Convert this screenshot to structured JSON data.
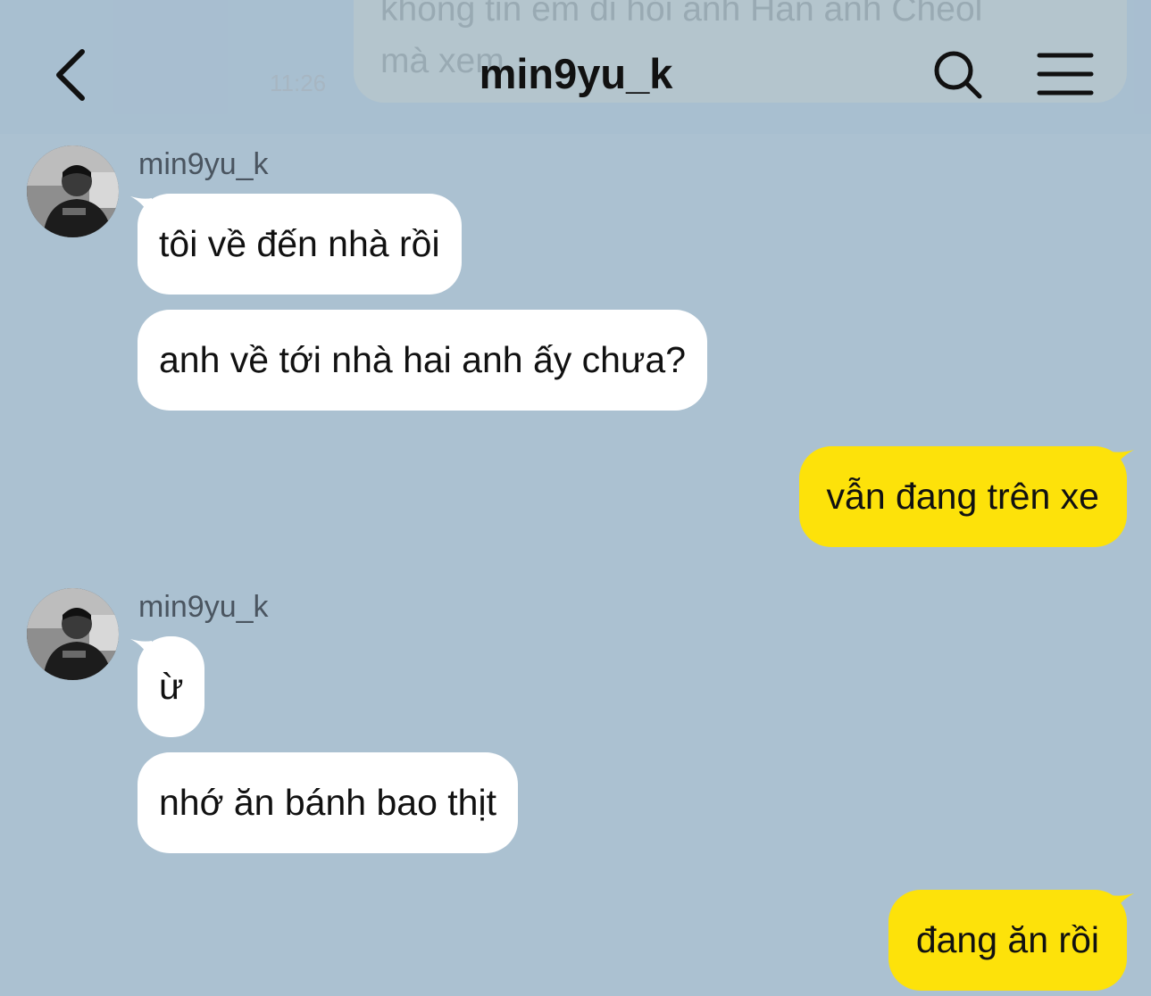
{
  "header": {
    "title": "min9yu_k",
    "previous_message_text": "không tin em đi hỏi anh Han anh Cheol\nmà xem",
    "previous_message_time": "11:26",
    "back_icon": "chevron-left-icon",
    "search_icon": "search-icon",
    "menu_icon": "hamburger-menu-icon"
  },
  "colors": {
    "background": "#abc1d1",
    "incoming_bubble": "#ffffff",
    "outgoing_bubble": "#fde20a",
    "text": "#111111"
  },
  "messages": [
    {
      "direction": "incoming",
      "sender": "min9yu_k",
      "text": "tôi về đến nhà rồi"
    },
    {
      "direction": "incoming",
      "text": "anh về tới nhà hai anh ấy chưa?"
    },
    {
      "direction": "outgoing",
      "text": "vẫn đang trên xe"
    },
    {
      "direction": "incoming",
      "sender": "min9yu_k",
      "text": "ừ"
    },
    {
      "direction": "incoming",
      "text": "nhớ ăn bánh bao thịt"
    },
    {
      "direction": "outgoing",
      "text": "đang ăn rồi"
    }
  ]
}
